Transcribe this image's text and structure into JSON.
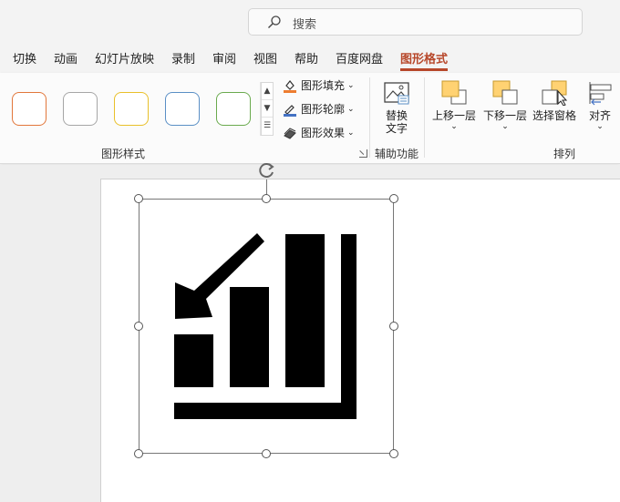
{
  "search": {
    "placeholder": "搜索",
    "icon": "search-icon"
  },
  "tabs": [
    {
      "label": "切换",
      "active": false
    },
    {
      "label": "动画",
      "active": false
    },
    {
      "label": "幻灯片放映",
      "active": false
    },
    {
      "label": "录制",
      "active": false
    },
    {
      "label": "审阅",
      "active": false
    },
    {
      "label": "视图",
      "active": false
    },
    {
      "label": "帮助",
      "active": false
    },
    {
      "label": "百度网盘",
      "active": false
    },
    {
      "label": "图形格式",
      "active": true
    }
  ],
  "ribbon": {
    "shape_styles": {
      "swatch_colors": [
        "#e2773b",
        "#a6a6a6",
        "#e9c02a",
        "#5a8fc5",
        "#6aaa4e"
      ],
      "fill_label": "图形填充",
      "outline_label": "图形轮廓",
      "effects_label": "图形效果",
      "group_label": "图形样式",
      "fill_color": "#ed7d31",
      "outline_color": "#4472c4"
    },
    "accessibility": {
      "alt_text_label_line1": "替换",
      "alt_text_label_line2": "文字",
      "group_label": "辅助功能"
    },
    "arrange": {
      "bring_forward_label": "上移一层",
      "send_backward_label": "下移一层",
      "selection_pane_label": "选择窗格",
      "align_label": "对齐",
      "group_label": "排列",
      "icon_color": "#ffd272"
    }
  },
  "colors": {
    "accent": "#b7472a",
    "graphic": "#000000"
  }
}
